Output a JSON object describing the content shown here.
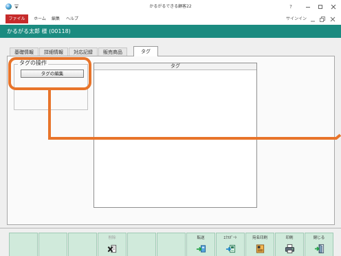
{
  "window": {
    "title": "かるがるできる顧客22",
    "help_label": "?",
    "icons": {
      "app": "app-globe-icon",
      "quick_access": "quick-access-dropdown-icon",
      "minimize": "minimize-icon",
      "maximize": "maximize-icon",
      "close": "close-icon"
    }
  },
  "ribbon": {
    "menu_items": [
      {
        "label": "ファイル",
        "active": true
      },
      {
        "label": "ホーム",
        "active": false
      },
      {
        "label": "編集",
        "active": false
      },
      {
        "label": "ヘルプ",
        "active": false
      }
    ],
    "signin_label": "サインイン",
    "icons": {
      "collapse_ribbon": "ribbon-minimize-icon",
      "restore": "restore-window-icon",
      "close": "close-document-icon"
    }
  },
  "customer_header": {
    "title": "かるがる太郎 様 (00118)"
  },
  "tabs": [
    {
      "label": "基礎情報",
      "selected": false
    },
    {
      "label": "詳細情報",
      "selected": false
    },
    {
      "label": "対応記録",
      "selected": false
    },
    {
      "label": "販売商品",
      "selected": false
    },
    {
      "label": "タグ",
      "selected": true
    }
  ],
  "tag_operations": {
    "group_label": "タグの操作",
    "edit_button_label": "タグの編集"
  },
  "tag_list": {
    "column_header": "タグ",
    "rows": []
  },
  "toolbar": {
    "buttons": [
      {
        "label": "",
        "icon": "",
        "disabled": false
      },
      {
        "label": "",
        "icon": "",
        "disabled": false
      },
      {
        "label": "",
        "icon": "",
        "disabled": false
      },
      {
        "label": "削除",
        "icon": "delete-icon",
        "disabled": true
      },
      {
        "label": "",
        "icon": "",
        "disabled": false
      },
      {
        "label": "",
        "icon": "",
        "disabled": false
      },
      {
        "label": "転送",
        "icon": "transfer-icon",
        "disabled": false
      },
      {
        "label": "ｴｸｽﾎﾟｰﾄ",
        "icon": "export-icon",
        "disabled": false
      },
      {
        "label": "宛名印刷",
        "icon": "address-print-icon",
        "disabled": false
      },
      {
        "label": "印刷",
        "icon": "printer-icon",
        "disabled": false
      },
      {
        "label": "閉じる",
        "icon": "close-exit-icon",
        "disabled": false
      }
    ]
  },
  "colors": {
    "accent_teal": "#1b8b80",
    "file_tab_red": "#c62b2b",
    "highlight_orange": "#e8742a",
    "toolbar_button_green": "#d0eadb",
    "toolbar_button_border": "#9fcab4"
  }
}
